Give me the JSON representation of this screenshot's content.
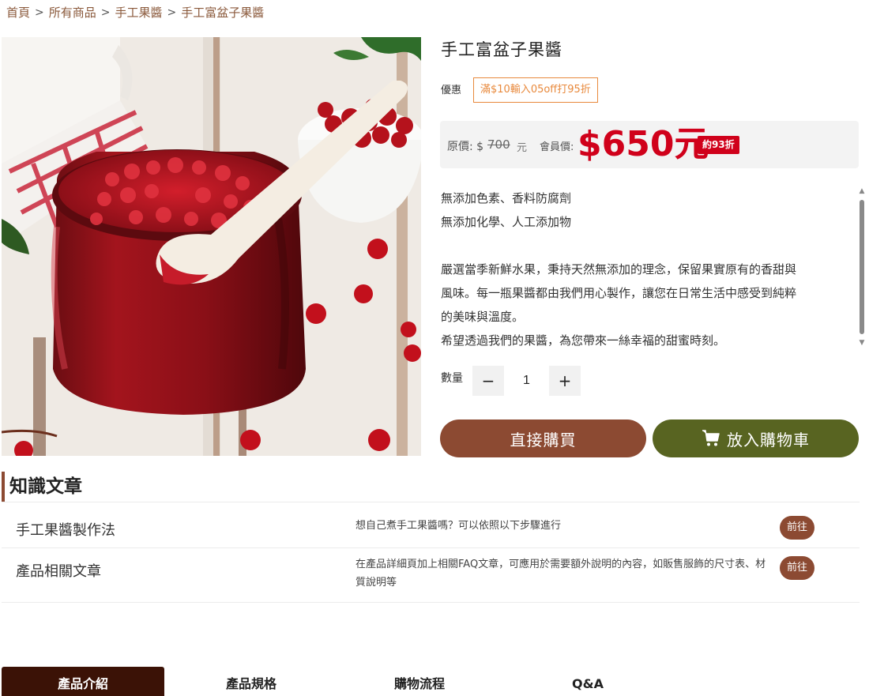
{
  "breadcrumb": {
    "items": [
      "首頁",
      "所有商品",
      "手工果醬",
      "手工富盆子果醬"
    ],
    "separator": ">"
  },
  "product": {
    "title": "手工富盆子果醬",
    "image_alt_icon": "raspberry-jam-jar-photo",
    "promo_label": "優惠",
    "promo_tag": "滿$10輸入05off打95折",
    "original_price_label": "原價:",
    "original_currency": "$",
    "original_price": "700",
    "original_unit": "元",
    "member_price_label": "會員價:",
    "member_price": "$650元",
    "discount_badge": "約93折",
    "description_lines_1": [
      "無添加色素、香料防腐劑",
      "無添加化學、人工添加物"
    ],
    "description_lines_2": [
      "嚴選當季新鮮水果，秉持天然無添加的理念，保留果實原有的香甜與",
      "風味。每一瓶果醬都由我們用心製作，讓您在日常生活中感受到純粹",
      "的美味與溫度。",
      "希望透過我們的果醬，為您帶來一絲幸福的甜蜜時刻。"
    ],
    "quantity_label": "數量",
    "quantity_value": "1",
    "minus_symbol": "−",
    "plus_symbol": "+",
    "buy_now_label": "直接購買",
    "add_to_cart_label": "放入購物車"
  },
  "articles": {
    "heading": "知識文章",
    "rows": [
      {
        "title": "手工果醬製作法",
        "desc": "想自己煮手工果醬嗎？可以依照以下步驟進行",
        "button": "前往"
      },
      {
        "title": "產品相關文章",
        "desc": "在產品詳細頁加上相關FAQ文章，可應用於需要額外說明的內容，如販售服飾的尺寸表、材質說明等",
        "button": "前往"
      }
    ]
  },
  "tabs": [
    {
      "label": "產品介紹",
      "active": true
    },
    {
      "label": "產品規格",
      "active": false
    },
    {
      "label": "購物流程",
      "active": false
    },
    {
      "label": "Q&A",
      "active": false
    }
  ],
  "colors": {
    "accent_brown": "#8c4a32",
    "accent_olive": "#586421",
    "price_red": "#d0011b",
    "promo_orange": "#e8893c",
    "tab_active": "#3b1206"
  }
}
